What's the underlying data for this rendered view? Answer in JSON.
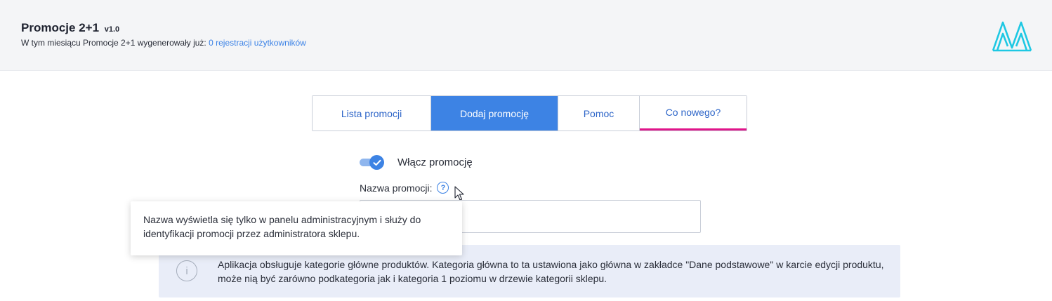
{
  "header": {
    "app_name": "Promocje 2+1",
    "version": "v1.0",
    "subtitle_prefix": "W tym miesiącu Promocje 2+1 wygenerowały już:",
    "subtitle_link": "0 rejestracji użytkowników"
  },
  "tabs": [
    {
      "label": "Lista promocji",
      "active": false
    },
    {
      "label": "Dodaj promocję",
      "active": true
    },
    {
      "label": "Pomoc",
      "active": false
    },
    {
      "label": "Co nowego?",
      "active": false
    }
  ],
  "form": {
    "toggle_label": "Włącz promocję",
    "toggle_on": true,
    "name_label": "Nazwa promocji:",
    "help_icon_glyph": "?",
    "name_value": ""
  },
  "tooltip": {
    "text": "Nazwa wyświetla się tylko w panelu administracyjnym i służy do identyfikacji promocji przez administratora sklepu."
  },
  "info": {
    "icon_glyph": "i",
    "text": "Aplikacja obsługuje kategorie główne produktów. Kategoria główna to ta ustawiona jako główna w zakładce \"Dane podstawowe\" w karcie edycji produktu, może nią być zarówno podkategoria jak i kategoria 1 poziomu w drzewie kategorii sklepu."
  },
  "colors": {
    "accent": "#3d83e4",
    "new_tab_underline": "#e0158a",
    "logo": "#1ec8e3",
    "info_bg": "#e9edf8"
  }
}
